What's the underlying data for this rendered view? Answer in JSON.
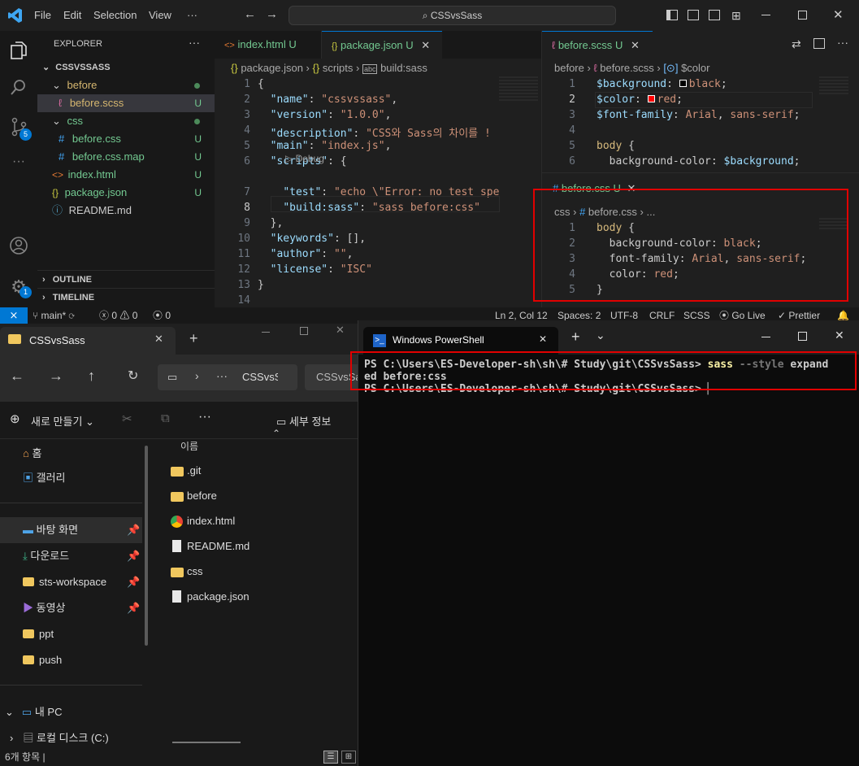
{
  "vscode": {
    "menu": [
      "File",
      "Edit",
      "Selection",
      "View",
      "···"
    ],
    "command_center": "CSSvsSass",
    "explorer_title": "EXPLORER",
    "workspace": "CSSVSSASS",
    "tree": [
      {
        "label": "before",
        "status": "",
        "kind": "folder"
      },
      {
        "label": "before.scss",
        "status": "U",
        "kind": "scss"
      },
      {
        "label": "css",
        "status": "",
        "kind": "folder"
      },
      {
        "label": "before.css",
        "status": "U",
        "kind": "css"
      },
      {
        "label": "before.css.map",
        "status": "U",
        "kind": "css"
      },
      {
        "label": "index.html",
        "status": "U",
        "kind": "html"
      },
      {
        "label": "package.json",
        "status": "U",
        "kind": "json"
      },
      {
        "label": "README.md",
        "status": "",
        "kind": "info"
      }
    ],
    "outline": "OUTLINE",
    "timeline": "TIMELINE",
    "tabs_left": [
      {
        "label": "index.html",
        "status": "U"
      },
      {
        "label": "package.json",
        "status": "U"
      }
    ],
    "tab_right": {
      "label": "before.scss",
      "status": "U"
    },
    "breadcrumb_left": [
      "package.json",
      "scripts",
      "build:sass"
    ],
    "breadcrumb_right": [
      "before",
      "before.scss",
      "$color"
    ],
    "package_lines": [
      {
        "n": "1",
        "t": "{"
      },
      {
        "n": "2",
        "t": "  \"name\": \"cssvssass\","
      },
      {
        "n": "3",
        "t": "  \"version\": \"1.0.0\","
      },
      {
        "n": "4",
        "t": "  \"description\": \"CSS와 Sass의 차이를 !"
      },
      {
        "n": "5",
        "t": "  \"main\": \"index.js\","
      },
      {
        "n": "6",
        "t": "  \"scripts\": {"
      },
      {
        "n": "7",
        "t": "    \"test\": \"echo \\\"Error: no test spe"
      },
      {
        "n": "8",
        "t": "    \"build:sass\": \"sass before:css\""
      },
      {
        "n": "9",
        "t": "  },"
      },
      {
        "n": "10",
        "t": "  \"keywords\": [],"
      },
      {
        "n": "11",
        "t": "  \"author\": \"\","
      },
      {
        "n": "12",
        "t": "  \"license\": \"ISC\""
      },
      {
        "n": "13",
        "t": "}"
      },
      {
        "n": "14",
        "t": ""
      }
    ],
    "debug_label": "Debug",
    "scss_lines": [
      {
        "n": "1",
        "t": "$background: ■black;"
      },
      {
        "n": "2",
        "t": "$color: ■red;"
      },
      {
        "n": "3",
        "t": "$font-family: Arial, sans-serif;"
      },
      {
        "n": "4",
        "t": ""
      },
      {
        "n": "5",
        "t": "body {"
      },
      {
        "n": "6",
        "t": "  background-color: $background;"
      }
    ],
    "css_tab": {
      "label": "before.css",
      "status": "U"
    },
    "css_breadcrumb": [
      "css",
      "before.css",
      "..."
    ],
    "css_lines": [
      {
        "n": "1",
        "t": "body {"
      },
      {
        "n": "2",
        "t": "  background-color: black;"
      },
      {
        "n": "3",
        "t": "  font-family: Arial, sans-serif;"
      },
      {
        "n": "4",
        "t": "  color: red;"
      },
      {
        "n": "5",
        "t": "}"
      }
    ],
    "status": {
      "branch": "main*",
      "errors": "0",
      "warnings": "0",
      "ports": "0",
      "position": "Ln 2, Col 12",
      "spaces": "Spaces: 2",
      "encoding": "UTF-8",
      "eol": "CRLF",
      "language": "SCSS",
      "golive": "Go Live",
      "prettier": "Prettier"
    },
    "source_control_badge": "5",
    "settings_badge": "1"
  },
  "file_explorer": {
    "tab_title": "CSSvsSass",
    "address": [
      "CSSvsS",
      "CSSvsSa"
    ],
    "new_button": "새로 만들기",
    "details_button": "세부 정보",
    "column_name": "이름",
    "nav": [
      {
        "label": "홈",
        "pinned": false
      },
      {
        "label": "갤러리",
        "pinned": false
      },
      {
        "label": "바탕 화면",
        "pinned": true
      },
      {
        "label": "다운로드",
        "pinned": true
      },
      {
        "label": "sts-workspace",
        "pinned": true
      },
      {
        "label": "동영상",
        "pinned": true
      },
      {
        "label": "ppt",
        "pinned": false
      },
      {
        "label": "push",
        "pinned": false
      },
      {
        "label": "내 PC",
        "pinned": false
      },
      {
        "label": "로컬 디스크 (C:)",
        "pinned": false
      }
    ],
    "files": [
      {
        "name": ".git",
        "kind": "folder"
      },
      {
        "name": "before",
        "kind": "folder"
      },
      {
        "name": "index.html",
        "kind": "chrome"
      },
      {
        "name": "README.md",
        "kind": "doc"
      },
      {
        "name": "css",
        "kind": "folder"
      },
      {
        "name": "package.json",
        "kind": "doc"
      }
    ],
    "item_count": "6개 항목"
  },
  "powershell": {
    "title": "Windows PowerShell",
    "prompt1": "PS C:\\Users\\ES-Developer-sh\\sh\\# Study\\git\\CSSvsSass>",
    "cmd": "sass",
    "flag": "--style",
    "arg1": "expand",
    "arg2": "ed before:css",
    "prompt2": "PS C:\\Users\\ES-Developer-sh\\sh\\# Study\\git\\CSSvsSass>"
  }
}
